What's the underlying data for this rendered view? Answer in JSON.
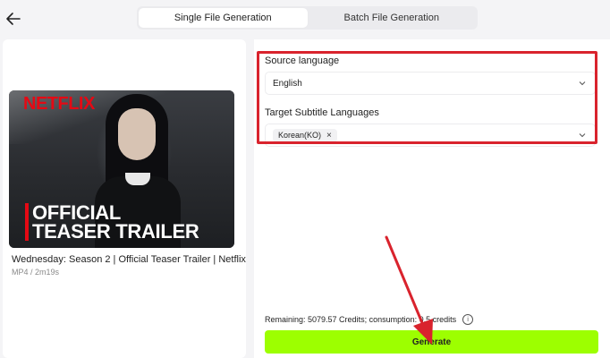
{
  "header": {
    "back_icon": "arrow-left-icon",
    "tabs": [
      {
        "label": "Single File Generation",
        "active": true
      },
      {
        "label": "Batch File Generation",
        "active": false
      }
    ]
  },
  "video": {
    "thumbnail_brand": "NETFLIX",
    "thumbnail_headline_1": "OFFICIAL",
    "thumbnail_headline_2": "TEASER TRAILER",
    "title": "Wednesday: Season 2 | Official Teaser Trailer | Netflix",
    "meta": "MP4 / 2m19s"
  },
  "form": {
    "source_language_label": "Source language",
    "source_language_value": "English",
    "target_label": "Target Subtitle Languages",
    "target_chips": [
      "Korean(KO)"
    ]
  },
  "footer": {
    "remaining_text": "Remaining: 5079.57 Credits; consumption: 0.5 credits",
    "generate_label": "Generate"
  },
  "colors": {
    "accent": "#9dff00",
    "annotation": "#d9232d",
    "netflix": "#e50914"
  }
}
